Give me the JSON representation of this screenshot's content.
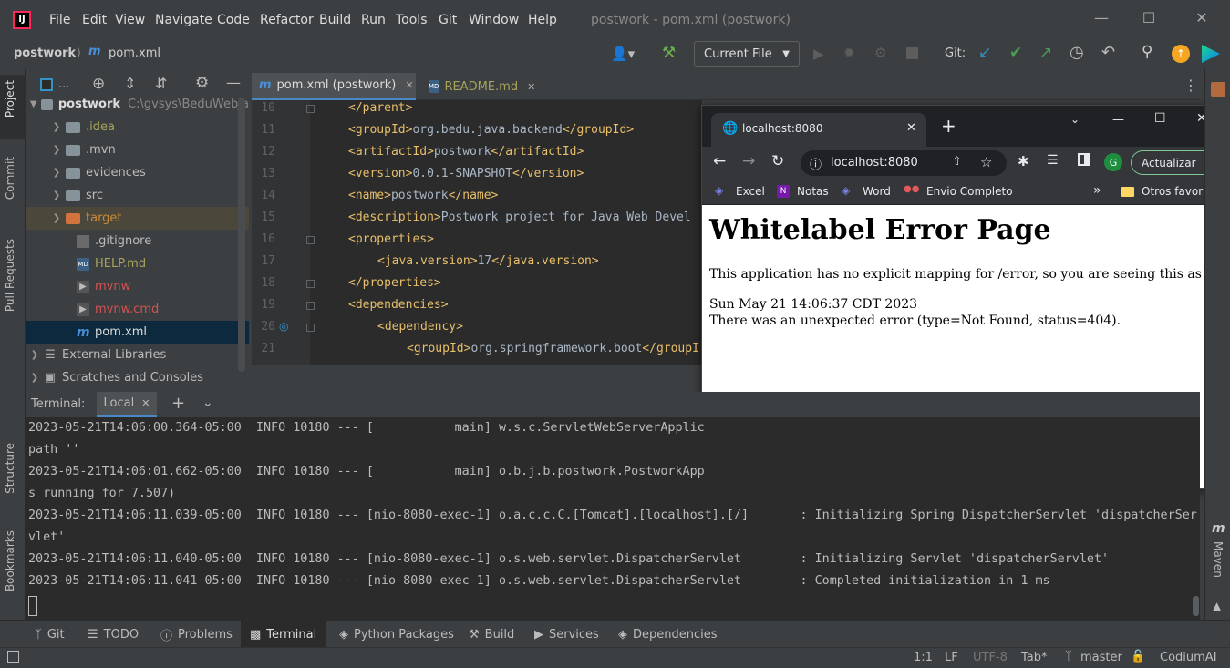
{
  "app": {
    "menu": [
      "File",
      "Edit",
      "View",
      "Navigate",
      "Code",
      "Refactor",
      "Build",
      "Run",
      "Tools",
      "Git",
      "Window",
      "Help"
    ],
    "window_title": "postwork - pom.xml (postwork)"
  },
  "navbar": {
    "breadcrumb_project": "postwork",
    "breadcrumb_file": "pom.xml",
    "run_config": "Current File",
    "git_label": "Git:"
  },
  "left_strip": {
    "tabs": [
      "Project",
      "Commit",
      "Pull Requests",
      "Structure",
      "Bookmarks"
    ]
  },
  "project_tree": {
    "toolbar_label": "...",
    "root_name": "postwork",
    "root_path": "C:\\gvsys\\BeduWebJa",
    "items": [
      {
        "name": ".idea",
        "kind": "folder",
        "color": "#a8a35b"
      },
      {
        "name": ".mvn",
        "kind": "folder",
        "color": "#bbbbbb"
      },
      {
        "name": "evidences",
        "kind": "folder",
        "color": "#bbbbbb"
      },
      {
        "name": "src",
        "kind": "folder",
        "color": "#bbbbbb"
      },
      {
        "name": "target",
        "kind": "folder-excluded",
        "color": "#c98c3b"
      },
      {
        "name": ".gitignore",
        "kind": "file",
        "color": "#bbbbbb"
      },
      {
        "name": "HELP.md",
        "kind": "file",
        "color": "#a8a35b"
      },
      {
        "name": "mvnw",
        "kind": "file",
        "color": "#d25252"
      },
      {
        "name": "mvnw.cmd",
        "kind": "file",
        "color": "#d25252"
      },
      {
        "name": "pom.xml",
        "kind": "file-selected",
        "color": "#bbbbbb"
      }
    ],
    "external_libraries": "External Libraries",
    "scratches": "Scratches and Consoles"
  },
  "editor": {
    "tabs": [
      {
        "label": "pom.xml (postwork)",
        "active": true
      },
      {
        "label": "README.md",
        "active": false
      }
    ],
    "lines": [
      {
        "n": "10",
        "indent": 0,
        "parts": [
          [
            "tag",
            "</parent>"
          ]
        ]
      },
      {
        "n": "11",
        "indent": 0,
        "parts": [
          [
            "tag",
            "<groupId>"
          ],
          [
            "text",
            "org.bedu.java.backend"
          ],
          [
            "tag",
            "</groupId>"
          ]
        ]
      },
      {
        "n": "12",
        "indent": 0,
        "parts": [
          [
            "tag",
            "<artifactId>"
          ],
          [
            "text",
            "postwork"
          ],
          [
            "tag",
            "</artifactId>"
          ]
        ]
      },
      {
        "n": "13",
        "indent": 0,
        "parts": [
          [
            "tag",
            "<version>"
          ],
          [
            "text",
            "0.0.1-SNAPSHOT"
          ],
          [
            "tag",
            "</version>"
          ]
        ]
      },
      {
        "n": "14",
        "indent": 0,
        "parts": [
          [
            "tag",
            "<name>"
          ],
          [
            "text",
            "postwork"
          ],
          [
            "tag",
            "</name>"
          ]
        ]
      },
      {
        "n": "15",
        "indent": 0,
        "parts": [
          [
            "tag",
            "<description>"
          ],
          [
            "text",
            "Postwork project for Java Web Devel"
          ]
        ]
      },
      {
        "n": "16",
        "indent": 0,
        "parts": [
          [
            "tag",
            "<properties>"
          ]
        ]
      },
      {
        "n": "17",
        "indent": 1,
        "parts": [
          [
            "tag",
            "<java.version>"
          ],
          [
            "text",
            "17"
          ],
          [
            "tag",
            "</java.version>"
          ]
        ]
      },
      {
        "n": "18",
        "indent": 0,
        "parts": [
          [
            "tag",
            "</properties>"
          ]
        ]
      },
      {
        "n": "19",
        "indent": 0,
        "parts": [
          [
            "tag",
            "<dependencies>"
          ]
        ]
      },
      {
        "n": "20",
        "indent": 1,
        "parts": [
          [
            "tag",
            "<dependency>"
          ]
        ]
      },
      {
        "n": "21",
        "indent": 2,
        "parts": [
          [
            "tag",
            "<groupId>"
          ],
          [
            "text",
            "org.springframework.boot"
          ],
          [
            "tag",
            "</groupI"
          ]
        ]
      }
    ]
  },
  "browser": {
    "tab_title": "localhost:8080",
    "address": "localhost:8080",
    "update_button": "Actualizar",
    "profile_initial": "G",
    "bookmarks": [
      "Excel",
      "Notas",
      "Word",
      "Envio Completo"
    ],
    "bookmarks_overflow": "»",
    "other_bookmarks": "Otros favoritos",
    "page": {
      "heading": "Whitelabel Error Page",
      "message": "This application has no explicit mapping for /error, so you are seeing this as a fallback.",
      "timestamp": "Sun May 21 14:06:37 CDT 2023",
      "error": "There was an unexpected error (type=Not Found, status=404)."
    }
  },
  "terminal": {
    "label": "Terminal:",
    "tab": "Local",
    "lines": [
      "2023-05-21T14:06:00.364-05:00  INFO 10180 --- [           main] w.s.c.ServletWebServerApplic",
      "path ''",
      "2023-05-21T14:06:01.662-05:00  INFO 10180 --- [           main] o.b.j.b.postwork.PostworkApp",
      "s running for 7.507)",
      "2023-05-21T14:06:11.039-05:00  INFO 10180 --- [nio-8080-exec-1] o.a.c.c.C.[Tomcat].[localhost].[/]       : Initializing Spring DispatcherServlet 'dispatcherSer",
      "vlet'",
      "2023-05-21T14:06:11.040-05:00  INFO 10180 --- [nio-8080-exec-1] o.s.web.servlet.DispatcherServlet        : Initializing Servlet 'dispatcherServlet'",
      "2023-05-21T14:06:11.041-05:00  INFO 10180 --- [nio-8080-exec-1] o.s.web.servlet.DispatcherServlet        : Completed initialization in 1 ms"
    ]
  },
  "right_strip": {
    "maven": "Maven"
  },
  "tool_windows": [
    {
      "label": "Git",
      "icon": "git-branch-icon"
    },
    {
      "label": "TODO",
      "icon": "list-icon"
    },
    {
      "label": "Problems",
      "icon": "info-icon"
    },
    {
      "label": "Terminal",
      "icon": "terminal-icon",
      "active": true
    },
    {
      "label": "Python Packages",
      "icon": "layers-icon"
    },
    {
      "label": "Build",
      "icon": "hammer-icon"
    },
    {
      "label": "Services",
      "icon": "play-circle-icon"
    },
    {
      "label": "Dependencies",
      "icon": "layers-icon"
    }
  ],
  "status_bar": {
    "position": "1:1",
    "line_sep": "LF",
    "encoding": "UTF-8",
    "indent": "Tab*",
    "branch": "master",
    "plugin": "CodiumAI"
  }
}
